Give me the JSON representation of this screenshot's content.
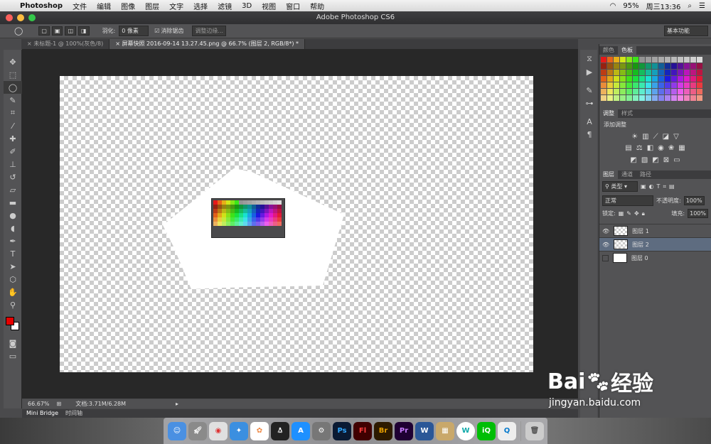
{
  "menubar": {
    "app": "Photoshop",
    "items": [
      "文件",
      "编辑",
      "图像",
      "图层",
      "文字",
      "选择",
      "滤镜",
      "3D",
      "视图",
      "窗口",
      "帮助"
    ],
    "battery": "95%",
    "clock": "周三13:36"
  },
  "window": {
    "title": "Adobe Photoshop CS6"
  },
  "options": {
    "feather_label": "羽化:",
    "feather_value": "0 像素",
    "antialias_label": "消除锯齿",
    "refine_edge": "调整边缘...",
    "workspace": "基本功能"
  },
  "tabs": [
    {
      "label": "未标题-1 @ 100%(灰色/8)"
    },
    {
      "label": "屏幕快照 2016-09-14 13.27.45.png @ 66.7% (图层 2, RGB/8*) *"
    }
  ],
  "status": {
    "zoom": "66.67%",
    "doc": "文档:3.71M/6.28M"
  },
  "bottom_tabs": {
    "mini_bridge": "Mini Bridge",
    "timeline": "时间轴"
  },
  "panels": {
    "swatch_tabs": [
      "颜色",
      "色板"
    ],
    "adjust_tabs": [
      "调整",
      "样式"
    ],
    "adjust_title": "添加调整",
    "layer_tabs": [
      "图层",
      "通道",
      "路径"
    ],
    "kind": "类型",
    "blend": "正常",
    "opacity_label": "不透明度:",
    "opacity": "100%",
    "lock_label": "锁定:",
    "fill_label": "填充:",
    "fill": "100%",
    "layers": [
      {
        "name": "图层 1",
        "visible": true
      },
      {
        "name": "图层 2",
        "visible": true
      },
      {
        "name": "图层 0",
        "visible": false
      }
    ]
  },
  "watermark": {
    "brand": "Bai",
    "brand2": "经验",
    "url": "jingyan.baidu.com"
  },
  "colors": {
    "fg": "#e60000",
    "bg": "#ffffff",
    "layer_sel": "#5e6c80"
  },
  "dock": [
    "Finder",
    "Launchpad",
    "Chrome",
    "Safari",
    "Photos",
    "QQ",
    "App Store",
    "System Preferences",
    "Ps",
    "Fl",
    "Br",
    "Pr",
    "Word",
    "Archive",
    "Wifi",
    "iQIYI",
    "Qt",
    "Trash"
  ]
}
